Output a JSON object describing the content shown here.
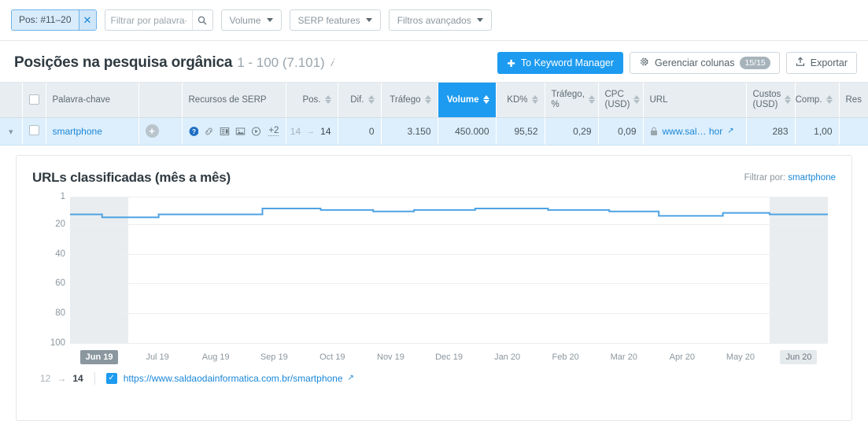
{
  "filterbar": {
    "chip": {
      "label": "Pos: #11–20",
      "close_icon": "close-x-icon"
    },
    "search": {
      "value": "",
      "placeholder": "Filtrar por palavra-c...",
      "icon": "search-icon"
    },
    "dropdowns": [
      {
        "label": "Volume"
      },
      {
        "label": "SERP features"
      },
      {
        "label": "Filtros avançados"
      }
    ]
  },
  "header": {
    "title": "Posições na pesquisa orgânica",
    "count": "1 - 100 (7.101)",
    "info_icon": "info-icon",
    "buttons": {
      "keyword_manager": "To Keyword Manager",
      "keyword_manager_icon": "plus-icon",
      "manage_columns": "Gerenciar colunas",
      "manage_columns_icon": "gear-icon",
      "manage_columns_badge": "15/15",
      "export": "Exportar",
      "export_icon": "upload-icon"
    }
  },
  "table": {
    "columns": [
      {
        "label": "Palavra-chave",
        "align": "left",
        "sortable": false
      },
      {
        "label": "Recursos de SERP",
        "align": "left",
        "sortable": false
      },
      {
        "label": "Pos.",
        "align": "right",
        "sortable": true
      },
      {
        "label": "Dif.",
        "align": "right",
        "sortable": true
      },
      {
        "label": "Tráfego",
        "align": "right",
        "sortable": true
      },
      {
        "label": "Volume",
        "align": "right",
        "sortable": true,
        "selected": true
      },
      {
        "label": "KD%",
        "align": "right",
        "sortable": true
      },
      {
        "label": "Tráfego, %",
        "align": "right",
        "sortable": true
      },
      {
        "label": "CPC (USD)",
        "align": "right",
        "sortable": true
      },
      {
        "label": "URL",
        "align": "left",
        "sortable": false
      },
      {
        "label": "Custos (USD)",
        "align": "right",
        "sortable": true
      },
      {
        "label": "Comp.",
        "align": "right",
        "sortable": true
      },
      {
        "label": "Res",
        "align": "left",
        "sortable": false
      }
    ],
    "rows": [
      {
        "expand_icon": "chevron-down-icon",
        "keyword": "smartphone",
        "add_icon": "plus-circle-icon",
        "serp_features": [
          "question-icon",
          "link-icon",
          "news-icon",
          "image-icon",
          "video-icon"
        ],
        "serp_more": "+2",
        "pos_old": "14",
        "pos_new": "14",
        "dif": "0",
        "trafego": "3.150",
        "volume": "450.000",
        "kd": "95,52",
        "trafego_pct": "0,29",
        "cpc": "0,09",
        "url_lock_icon": "lock-icon",
        "url": "www.sal… hor",
        "url_ext_icon": "external-link-icon",
        "custos": "283",
        "comp": "1,00",
        "res": ""
      }
    ]
  },
  "chart_panel": {
    "title": "URLs classificadas (mês a mês)",
    "filter_label": "Filtrar por:",
    "filter_value": "smartphone",
    "footer": {
      "pos_old": "12",
      "pos_arrow": "→",
      "pos_new": "14",
      "checkbox_icon": "checkbox-checked-icon",
      "url": "https://www.saldaodainformatica.com.br/smartphone",
      "ext_icon": "external-link-icon"
    }
  },
  "chart_data": {
    "type": "line",
    "title": "URLs classificadas (mês a mês)",
    "xlabel": "",
    "ylabel": "",
    "step": true,
    "ylim": [
      1,
      100
    ],
    "y_inverted": true,
    "yticks": [
      1,
      20,
      40,
      60,
      80,
      100
    ],
    "grid": true,
    "legend_position": "bottom",
    "line_color": "#4fa3e3",
    "highlighted_categories": [
      "Jun 19",
      "Jun 20"
    ],
    "categories": [
      "Jun 19",
      "Jul 19",
      "Aug 19",
      "Sep 19",
      "Oct 19",
      "Nov 19",
      "Dec 19",
      "Jan 20",
      "Feb 20",
      "Mar 20",
      "Apr 20",
      "May 20",
      "Jun 20"
    ],
    "series": [
      {
        "name": "https://www.saldaodainformatica.com.br/smartphone",
        "values": [
          13,
          15,
          13,
          9,
          8,
          10,
          11,
          9,
          10,
          12,
          15,
          13,
          13
        ]
      }
    ],
    "detailed_points": [
      {
        "x": 0.0,
        "y": 13
      },
      {
        "x": 0.55,
        "y": 13
      },
      {
        "x": 0.55,
        "y": 15
      },
      {
        "x": 1.52,
        "y": 15
      },
      {
        "x": 1.52,
        "y": 13
      },
      {
        "x": 3.3,
        "y": 13
      },
      {
        "x": 3.3,
        "y": 9
      },
      {
        "x": 4.3,
        "y": 9
      },
      {
        "x": 4.3,
        "y": 10
      },
      {
        "x": 5.2,
        "y": 10
      },
      {
        "x": 5.2,
        "y": 11
      },
      {
        "x": 5.9,
        "y": 11
      },
      {
        "x": 5.9,
        "y": 10
      },
      {
        "x": 6.95,
        "y": 10
      },
      {
        "x": 6.95,
        "y": 9
      },
      {
        "x": 8.2,
        "y": 9
      },
      {
        "x": 8.2,
        "y": 10
      },
      {
        "x": 9.25,
        "y": 10
      },
      {
        "x": 9.25,
        "y": 11
      },
      {
        "x": 10.1,
        "y": 11
      },
      {
        "x": 10.1,
        "y": 14
      },
      {
        "x": 11.2,
        "y": 14
      },
      {
        "x": 11.2,
        "y": 12
      },
      {
        "x": 12.0,
        "y": 12
      },
      {
        "x": 12.0,
        "y": 13
      },
      {
        "x": 13.0,
        "y": 13
      }
    ]
  }
}
